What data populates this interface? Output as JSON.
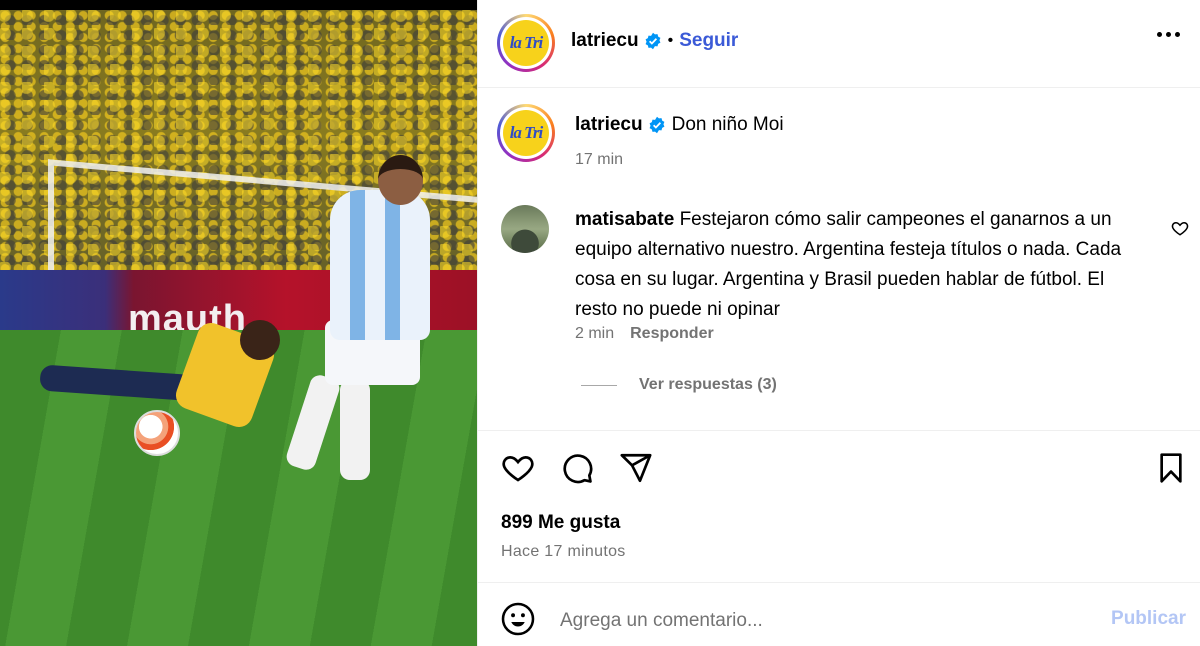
{
  "media": {
    "description_alt": "",
    "ad_text": "mauth"
  },
  "header": {
    "username": "latriecu",
    "avatar_logo_text": "la Tri",
    "separator": "•",
    "follow_label": "Seguir",
    "more_icon": "more-horizontal-icon"
  },
  "caption": {
    "username": "latriecu",
    "text": "Don niño Moi",
    "time": "17 min"
  },
  "comment": {
    "username": "matisabate",
    "text": "Festejaron cómo salir campeones el ganarnos a un equipo alternativo nuestro. Argentina festeja títulos o nada. Cada cosa en su lugar. Argentina y Brasil pueden hablar de fútbol. El resto no puede ni opinar",
    "time": "2 min",
    "reply_label": "Responder",
    "view_replies_label": "Ver respuestas (3)"
  },
  "actions": {
    "like_icon": "heart-icon",
    "comment_icon": "comment-icon",
    "share_icon": "send-icon",
    "save_icon": "bookmark-icon"
  },
  "stats": {
    "likes": "899 Me gusta",
    "posted_ago": "Hace 17 minutos"
  },
  "add_comment": {
    "placeholder": "Agrega un comentario...",
    "publish_label": "Publicar"
  },
  "colors": {
    "accent_blue": "#3b5ad7",
    "verified_blue": "#0095f6",
    "muted_text": "#737373",
    "publish_disabled": "#b3c6f5",
    "logo_yellow": "#f7d21b"
  }
}
